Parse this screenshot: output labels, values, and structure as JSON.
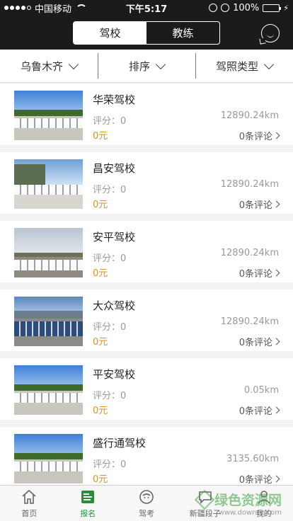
{
  "status": {
    "carrier": "中国移动",
    "time": "下午5:17",
    "battery": "100%"
  },
  "header": {
    "tabs": [
      {
        "label": "驾校",
        "active": true
      },
      {
        "label": "教练",
        "active": false
      }
    ],
    "chat_icon": "chat-bubble-icon"
  },
  "filters": [
    {
      "label": "乌鲁木齐"
    },
    {
      "label": "排序"
    },
    {
      "label": "驾照类型"
    }
  ],
  "schools": [
    {
      "name": "华荣驾校",
      "score": "评分：0",
      "price": "0元",
      "distance": "12890.24km",
      "reviews": "0条评论",
      "scene": "white-cars"
    },
    {
      "name": "昌安驾校",
      "score": "评分：0",
      "price": "0元",
      "distance": "12890.24km",
      "reviews": "0条评论",
      "scene": "white-cars-rocks"
    },
    {
      "name": "安平驾校",
      "score": "评分：0",
      "price": "0元",
      "distance": "12890.24km",
      "reviews": "0条评论",
      "scene": "lot-overcast"
    },
    {
      "name": "大众驾校",
      "score": "评分：0",
      "price": "0元",
      "distance": "12890.24km",
      "reviews": "0条评论",
      "scene": "blue-cars"
    },
    {
      "name": "平安驾校",
      "score": "评分：0",
      "price": "0元",
      "distance": "0.05km",
      "reviews": "0条评论",
      "scene": "white-cars"
    },
    {
      "name": "盛行通驾校",
      "score": "评分：0",
      "price": "0元",
      "distance": "3135.60km",
      "reviews": "0条评论",
      "scene": "white-cars"
    }
  ],
  "tabbar": [
    {
      "label": "首页",
      "icon": "home-icon",
      "active": false
    },
    {
      "label": "报名",
      "icon": "signup-icon",
      "active": true
    },
    {
      "label": "驾考",
      "icon": "exam-icon",
      "active": false
    },
    {
      "label": "新疆段子",
      "icon": "jokes-icon",
      "active": false
    },
    {
      "label": "我的",
      "icon": "profile-icon",
      "active": false
    }
  ],
  "watermark": {
    "title": "绿色资源网",
    "url": "www.downcc.com"
  },
  "colors": {
    "header_bg": "#1b1b1b",
    "price": "#e58e1a",
    "tab_active": "#2e8b3a"
  }
}
